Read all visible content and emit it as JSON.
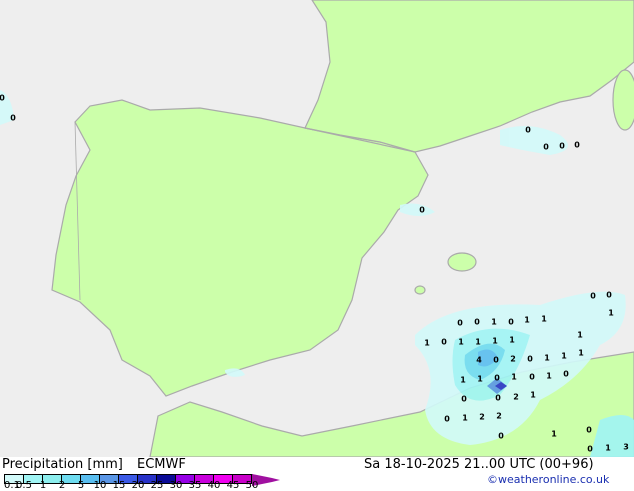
{
  "title": "Precipitation [mm]",
  "model": "ECMWF",
  "datetime": "Sa 18-10-2025 21..00 UTC (00+96)",
  "credit": "©weatheronline.co.uk",
  "legend": {
    "ticks": [
      "0.1",
      "0.5",
      "1",
      "2",
      "5",
      "10",
      "15",
      "20",
      "25",
      "30",
      "35",
      "40",
      "45",
      "50"
    ],
    "colors": [
      "#d2fafa",
      "#a0f5f5",
      "#8ceeee",
      "#6edcf0",
      "#5abef0",
      "#5a96e6",
      "#3c5ae6",
      "#2832c8",
      "#0a0a96",
      "#9600e6",
      "#c800dc",
      "#f000f0",
      "#c800c8"
    ]
  },
  "colors": {
    "land": "#ccffaa",
    "sea": "#eeeeee",
    "border": "#aaaaaa"
  },
  "values": [
    "0",
    "0",
    "1",
    "0",
    "0",
    "1",
    "0",
    "1",
    "1",
    "1",
    "1",
    "0",
    "1",
    "1",
    "1",
    "1",
    "4",
    "0",
    "2",
    "0",
    "1",
    "1",
    "1",
    "1",
    "1",
    "0",
    "1",
    "0",
    "1",
    "0",
    "0",
    "0",
    "2",
    "1",
    "0",
    "1",
    "2",
    "2",
    "0",
    "1",
    "0",
    "0",
    "1",
    "3",
    "0",
    "0",
    "0",
    "0",
    "0",
    "0",
    "0"
  ]
}
